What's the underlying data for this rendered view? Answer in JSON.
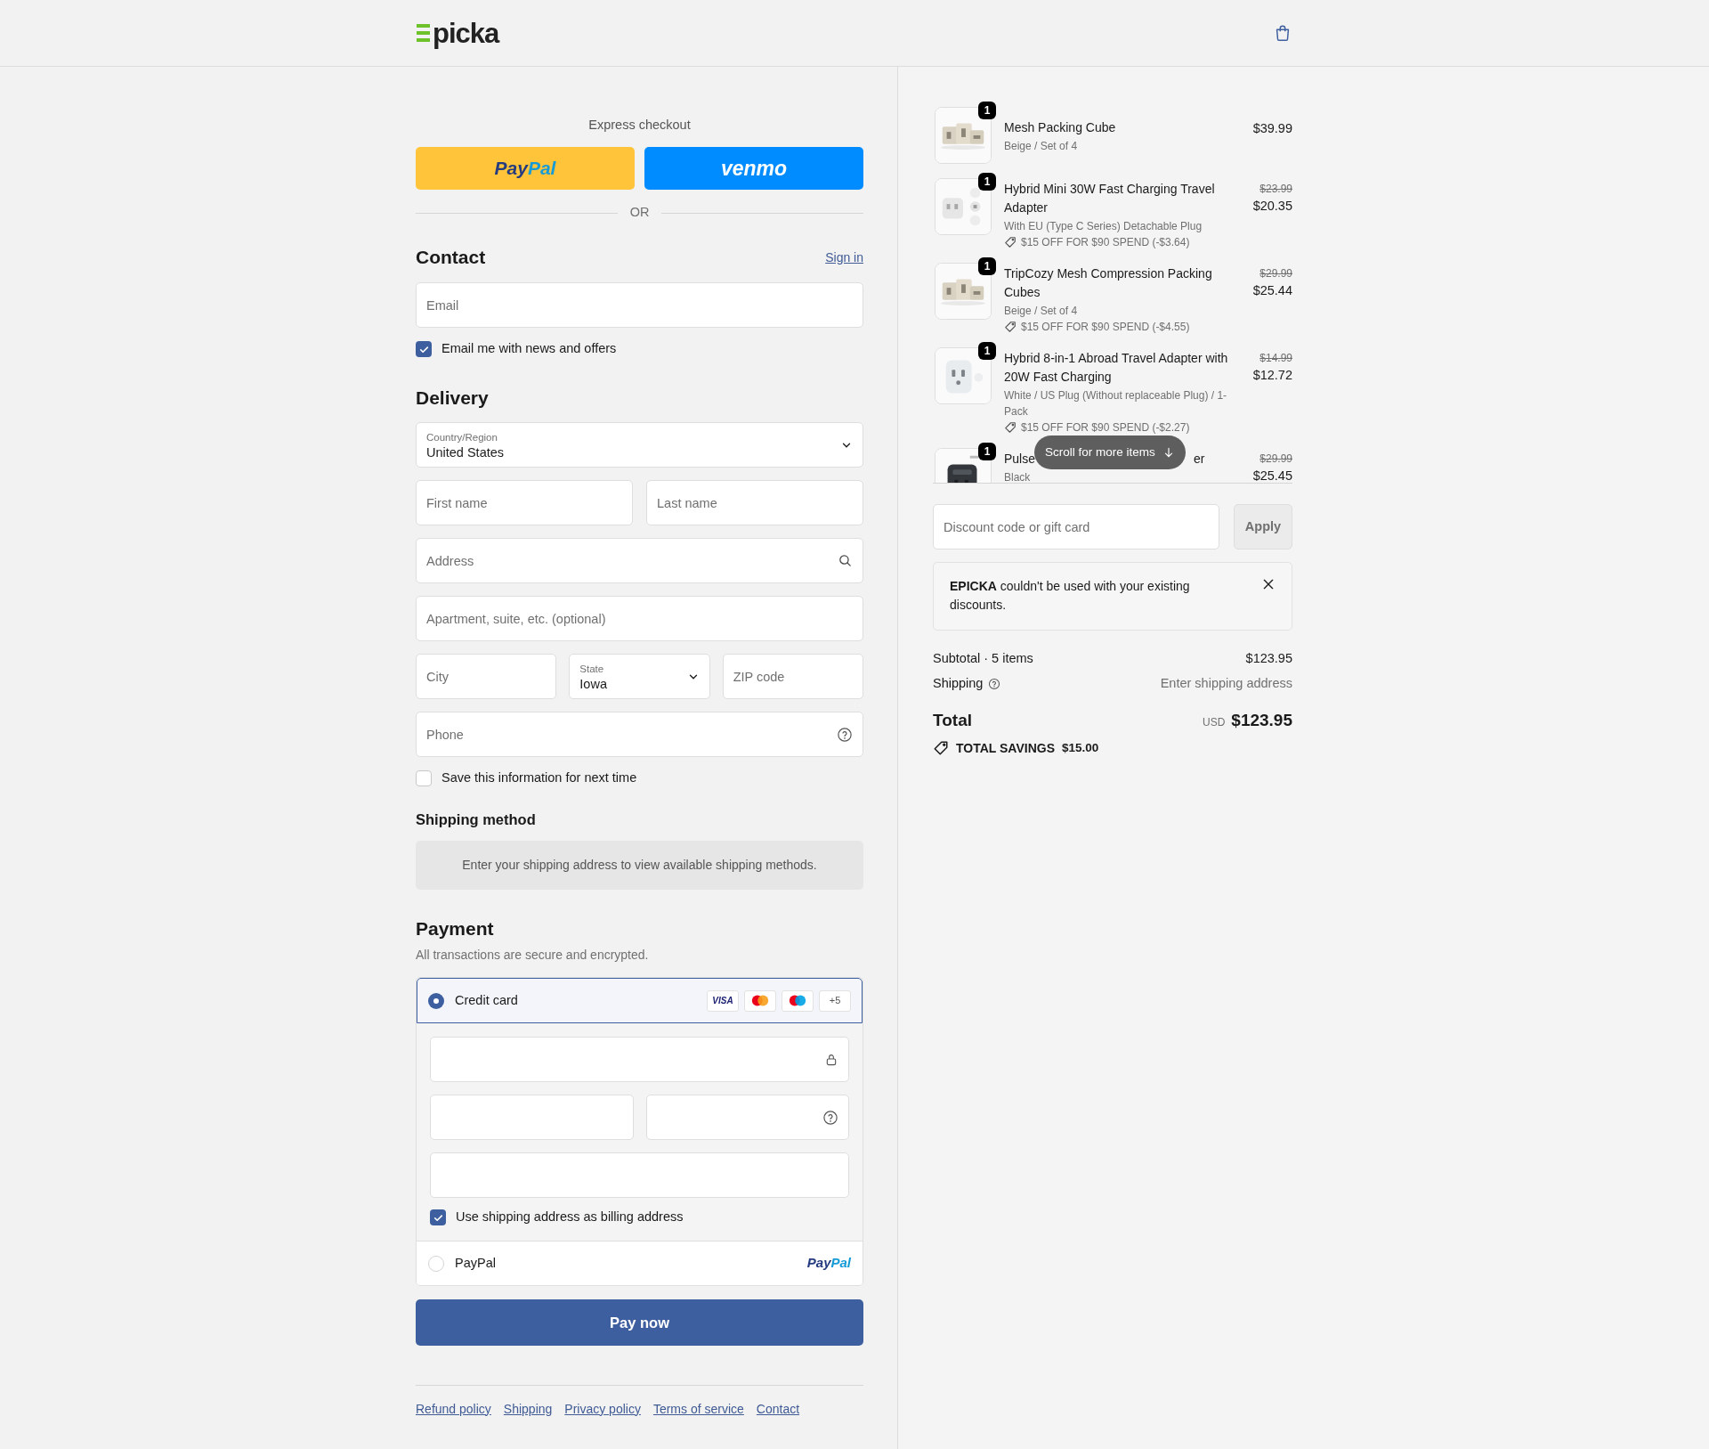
{
  "header": {
    "logo": "picka"
  },
  "express_checkout": {
    "label": "Express checkout",
    "buttons": [
      {
        "kind": "paypal",
        "logo_parts": [
          "Pay",
          "Pal"
        ]
      },
      {
        "kind": "venmo",
        "label": "venmo"
      }
    ],
    "divider": "OR"
  },
  "contact": {
    "heading": "Contact",
    "sign_in": "Sign in",
    "email": {
      "placeholder": "Email"
    },
    "newsletter": {
      "label": "Email me with news and offers",
      "checked": true
    }
  },
  "delivery": {
    "heading": "Delivery",
    "country": {
      "label": "Country/Region",
      "value": "United States"
    },
    "first_name": {
      "placeholder": "First name"
    },
    "last_name": {
      "placeholder": "Last name"
    },
    "address": {
      "placeholder": "Address"
    },
    "apartment": {
      "placeholder": "Apartment, suite, etc. (optional)"
    },
    "city": {
      "placeholder": "City"
    },
    "state": {
      "label": "State",
      "value": "Iowa"
    },
    "zip": {
      "placeholder": "ZIP code"
    },
    "phone": {
      "placeholder": "Phone"
    },
    "save_info": {
      "label": "Save this information for next time",
      "checked": false
    }
  },
  "shipping_method": {
    "heading": "Shipping method",
    "message": "Enter your shipping address to view available shipping methods."
  },
  "payment": {
    "heading": "Payment",
    "subtitle": "All transactions are secure and encrypted.",
    "methods": [
      {
        "kind": "card",
        "label": "Credit card",
        "selected": true,
        "brands": [
          {
            "kind": "visa",
            "label": "VISA"
          },
          {
            "kind": "mastercard"
          },
          {
            "kind": "maestro"
          },
          {
            "kind": "more",
            "label": "+5"
          }
        ],
        "billing_same": {
          "label": "Use shipping address as billing address",
          "checked": true
        }
      },
      {
        "kind": "paypal",
        "label": "PayPal",
        "selected": false,
        "logo_parts": [
          "Pay",
          "Pal"
        ]
      }
    ]
  },
  "pay_button": "Pay now",
  "footer_links": [
    "Refund policy",
    "Shipping",
    "Privacy policy",
    "Terms of service",
    "Contact"
  ],
  "order": {
    "items": [
      {
        "quantity": "1",
        "name_parts": [
          "Mesh Packing Cube"
        ],
        "variant": "Beige / Set of 4",
        "price": "$39.99"
      },
      {
        "quantity": "1",
        "name_parts": [
          "Hybrid Mini 30W Fast Charging Travel Adapter"
        ],
        "variant": "With EU (Type C Series) Detachable Plug",
        "discount": "$15 OFF FOR $90 SPEND (-$3.64)",
        "original_price": "$23.99",
        "price": "$20.35"
      },
      {
        "quantity": "1",
        "name_parts": [
          "TripCozy Mesh Compression Packing Cubes"
        ],
        "variant": "Beige / Set of 4",
        "discount": "$15 OFF FOR $90 SPEND (-$4.55)",
        "original_price": "$29.99",
        "price": "$25.44"
      },
      {
        "quantity": "1",
        "name_parts": [
          "Hybrid 8-in-1 Abroad Travel Adapter with 20W Fast Charging"
        ],
        "variant": "White / US Plug (Without replaceable Plug) / 1-Pack",
        "discount": "$15 OFF FOR $90 SPEND (-$2.27)",
        "original_price": "$14.99",
        "price": "$12.72"
      },
      {
        "quantity": "1",
        "name_parts": [
          "Pulse",
          "er"
        ],
        "variant": "Black",
        "original_price": "$29.99",
        "price": "$25.45"
      }
    ],
    "scroll_hint": "Scroll for more items",
    "discount_field": {
      "placeholder": "Discount code or gift card"
    },
    "apply": "Apply",
    "notice": "**EPICKA** couldn't be used with your existing discounts.",
    "subtotal_label": "Subtotal · 5 items",
    "subtotal": "$123.95",
    "shipping_label": "Shipping",
    "shipping_value": "Enter shipping address",
    "total_label": "Total",
    "currency": "USD",
    "total": "$123.95",
    "savings_label": "TOTAL SAVINGS",
    "savings": "$15.00"
  }
}
